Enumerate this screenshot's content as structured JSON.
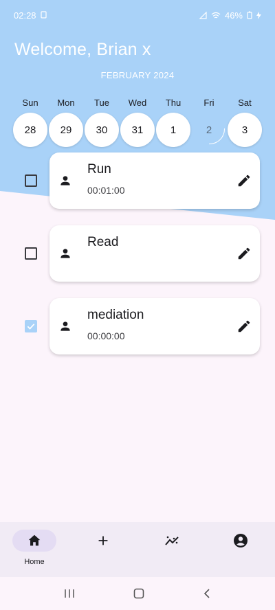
{
  "status_bar": {
    "time": "02:28",
    "battery": "46%"
  },
  "header": {
    "welcome": "Welcome, Brian x",
    "month": "FEBRUARY 2024"
  },
  "week": [
    {
      "name": "Sun",
      "date": "28"
    },
    {
      "name": "Mon",
      "date": "29"
    },
    {
      "name": "Tue",
      "date": "30"
    },
    {
      "name": "Wed",
      "date": "31"
    },
    {
      "name": "Thu",
      "date": "1"
    },
    {
      "name": "Fri",
      "date": "2",
      "selected": true
    },
    {
      "name": "Sat",
      "date": "3"
    }
  ],
  "tasks": [
    {
      "title": "Run",
      "time": "00:01:00",
      "checked": false
    },
    {
      "title": "Read",
      "time": "",
      "checked": false
    },
    {
      "title": "mediation",
      "time": "00:00:00",
      "checked": true
    }
  ],
  "bottom_nav": {
    "home_label": "Home"
  },
  "colors": {
    "accent_blue": "#a9d2f8",
    "nav_active": "#e4dcf3"
  },
  "icons": [
    "home-icon",
    "add-icon",
    "insights-icon",
    "account-icon",
    "person-icon",
    "edit-icon",
    "check-icon"
  ]
}
